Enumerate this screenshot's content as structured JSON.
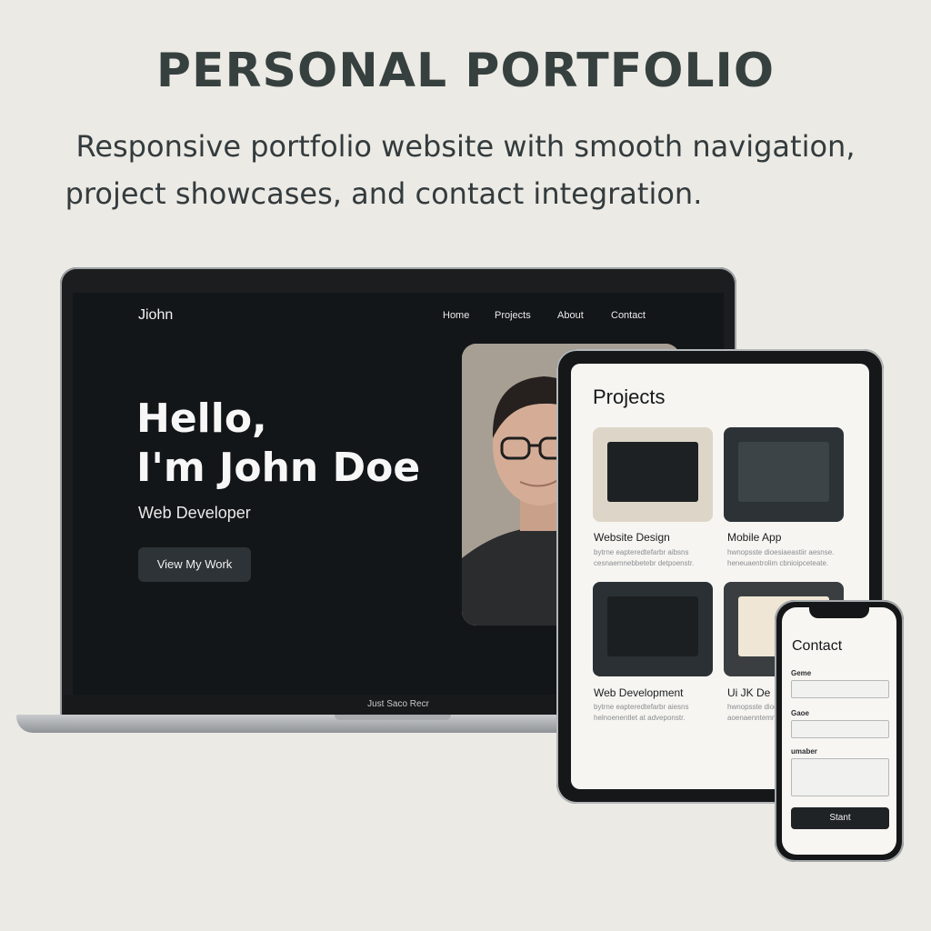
{
  "heading": {
    "title": "PERSONAL PORTFOLIO",
    "subtitle_line1": "Responsive portfolio website with smooth navigation,",
    "subtitle_line2": "project showcases, and contact integration."
  },
  "laptop": {
    "logo": "Jiohn",
    "nav": [
      "Home",
      "Projects",
      "About",
      "Contact"
    ],
    "hero_line1": "Hello,",
    "hero_line2": "I'm John Doe",
    "role": "Web Developer",
    "cta": "View My Work",
    "chin_label": "Just Saco Recr"
  },
  "tablet": {
    "title": "Projects",
    "projects": [
      {
        "label": "Website Design",
        "desc": "bytrne eapteredtefarbr aibsns cesnaemnebbetebr detpoenstr."
      },
      {
        "label": "Mobile App",
        "desc": "hwnopsste dioesiaeastiir aesnse. heneuaentrolim cbnioipceteate."
      },
      {
        "label": "Web Development",
        "desc": "bytrne eapteredtefarbr aiesns helnoenentlet at adveponstr."
      },
      {
        "label": "Ui JK De",
        "desc": "hwnopsste dioesiaeastir aesnss aoenaenntemn ahnioipceteate."
      }
    ]
  },
  "phone": {
    "title": "Contact",
    "field1_label": "Geme",
    "field2_label": "Gaoe",
    "field3_label": "umaber",
    "submit": "Stant"
  },
  "colors": {
    "page_bg": "#eceae5",
    "screen_dark": "#131618",
    "button_dark": "#1f2326"
  }
}
